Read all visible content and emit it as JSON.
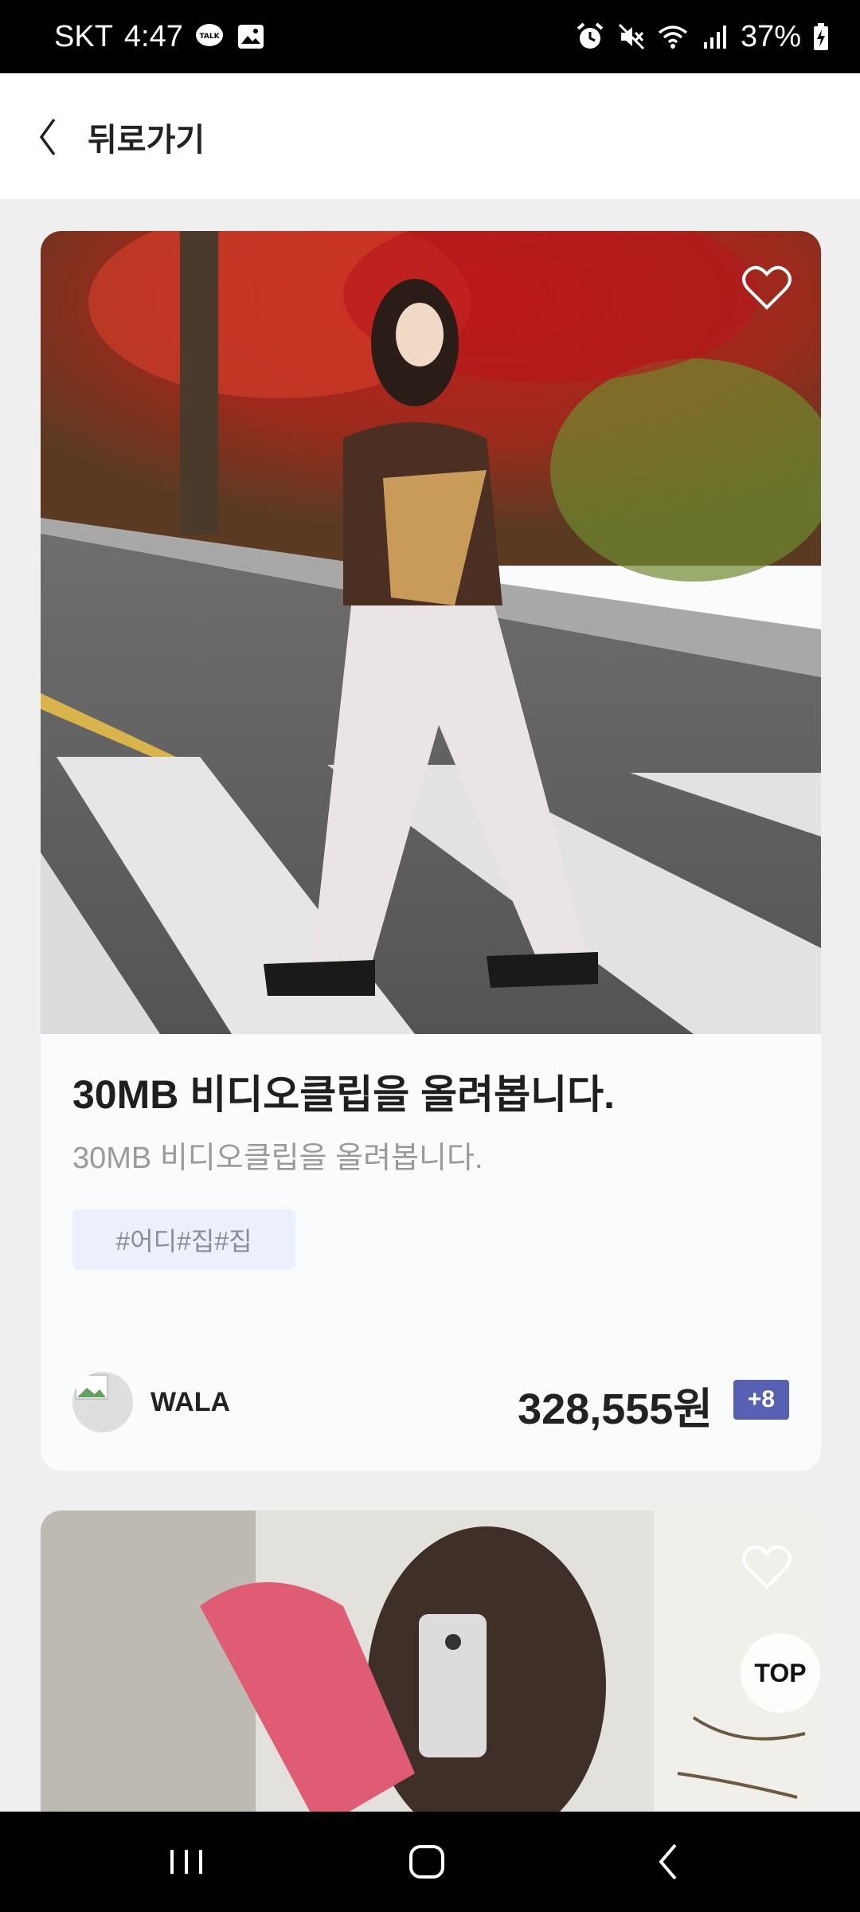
{
  "status_bar": {
    "carrier": "SKT",
    "time": "4:47",
    "battery_percent": "37%",
    "icons_left": [
      "kakaotalk-icon",
      "gallery-icon"
    ],
    "icons_right": [
      "alarm-icon",
      "mute-icon",
      "wifi-icon",
      "signal-icon",
      "battery-charging-icon"
    ]
  },
  "header": {
    "back_label": "뒤로가기"
  },
  "cards": [
    {
      "title": "30MB 비디오클립을 올려봅니다.",
      "subtitle": "30MB 비디오클립을 올려봅니다.",
      "tags": "#어디#집#집",
      "seller": "WALA",
      "price": "328,555원",
      "more_badge": "+8"
    }
  ],
  "top_button": "TOP",
  "colors": {
    "accent_badge": "#5661b3",
    "tag_bg": "#eceffc",
    "page_bg": "#efefef"
  }
}
